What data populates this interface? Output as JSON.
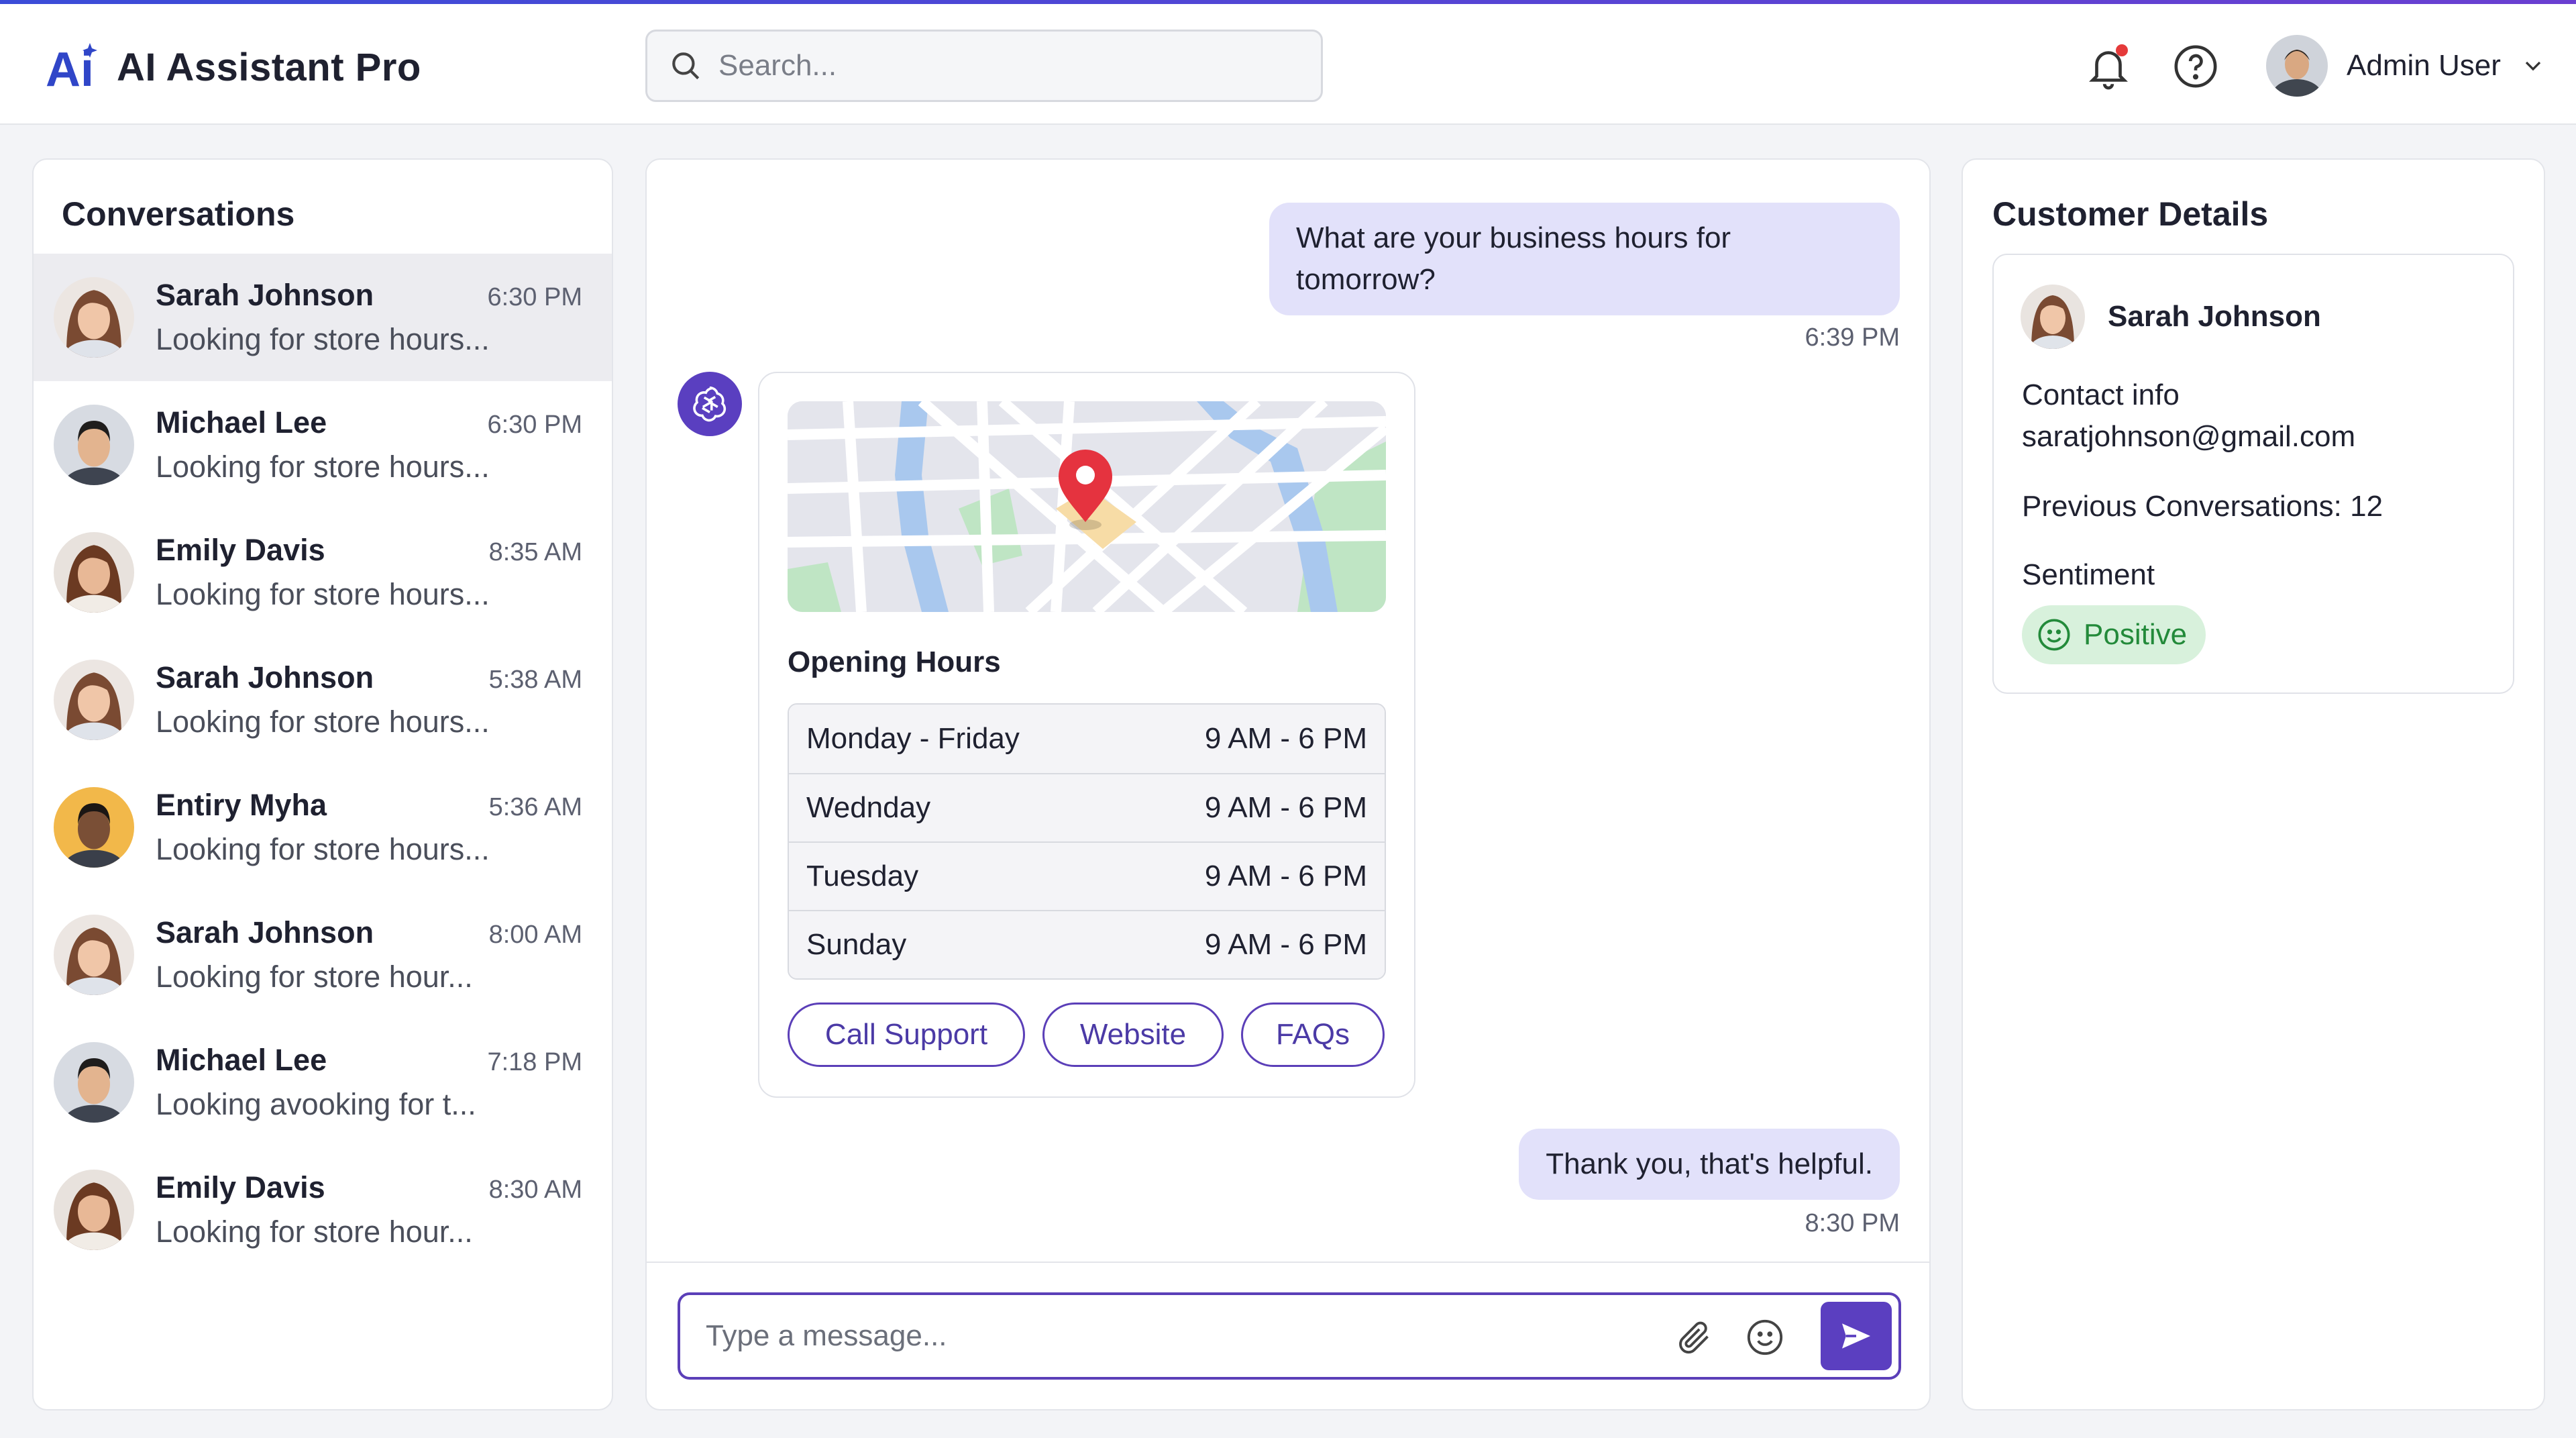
{
  "app": {
    "title": "AI Assistant Pro",
    "logo_text": "Ai"
  },
  "header": {
    "search_placeholder": "Search...",
    "user_name": "Admin User"
  },
  "conversations": {
    "title": "Conversations",
    "items": [
      {
        "name": "Sarah Johnson",
        "time": "6:30 PM",
        "preview": "Looking for store hours...",
        "avatar": "woman-light"
      },
      {
        "name": "Michael Lee",
        "time": "6:30 PM",
        "preview": "Looking for store hours...",
        "avatar": "man-asian"
      },
      {
        "name": "Emily Davis",
        "time": "8:35 AM",
        "preview": "Looking for store hours...",
        "avatar": "woman-brown"
      },
      {
        "name": "Sarah Johnson",
        "time": "5:38 AM",
        "preview": "Looking for store hours...",
        "avatar": "woman-light"
      },
      {
        "name": "Entiry Myha",
        "time": "5:36 AM",
        "preview": "Looking for store hours...",
        "avatar": "man-dark"
      },
      {
        "name": "Sarah Johnson",
        "time": "8:00 AM",
        "preview": "Looking for store hour...",
        "avatar": "woman-light"
      },
      {
        "name": "Michael Lee",
        "time": "7:18 PM",
        "preview": "Looking avooking for t...",
        "avatar": "man-asian"
      },
      {
        "name": "Emily Davis",
        "time": "8:30 AM",
        "preview": "Looking for store hour...",
        "avatar": "woman-brown"
      }
    ]
  },
  "chat": {
    "user_msg_1": {
      "line1": "What are your business hours for",
      "line2": "tomorrow?",
      "time": "6:39 PM"
    },
    "bot_card": {
      "hours_title": "Opening Hours",
      "hours": [
        {
          "day": "Monday - Friday",
          "hours": "9 AM - 6 PM"
        },
        {
          "day": "Wednday",
          "hours": "9 AM - 6 PM"
        },
        {
          "day": "Tuesday",
          "hours": "9 AM - 6 PM"
        },
        {
          "day": "Sunday",
          "hours": "9 AM - 6 PM"
        }
      ],
      "buttons": [
        "Call Support",
        "Website",
        "FAQs"
      ]
    },
    "user_msg_2": {
      "text": "Thank you, that's helpful.",
      "time": "8:30 PM"
    },
    "composer_placeholder": "Type a message..."
  },
  "customer": {
    "title": "Customer Details",
    "name": "Sarah Johnson",
    "contact_label": "Contact info",
    "email": "saratjohnson@gmail.com",
    "previous_conversations": "Previous Conversations: 12",
    "sentiment_label": "Sentiment",
    "sentiment_value": "Positive"
  },
  "colors": {
    "accent": "#5b3fc0",
    "user_bubble": "#e2e1fa",
    "positive_bg": "#d8f1dc",
    "positive_text": "#238a3a"
  }
}
